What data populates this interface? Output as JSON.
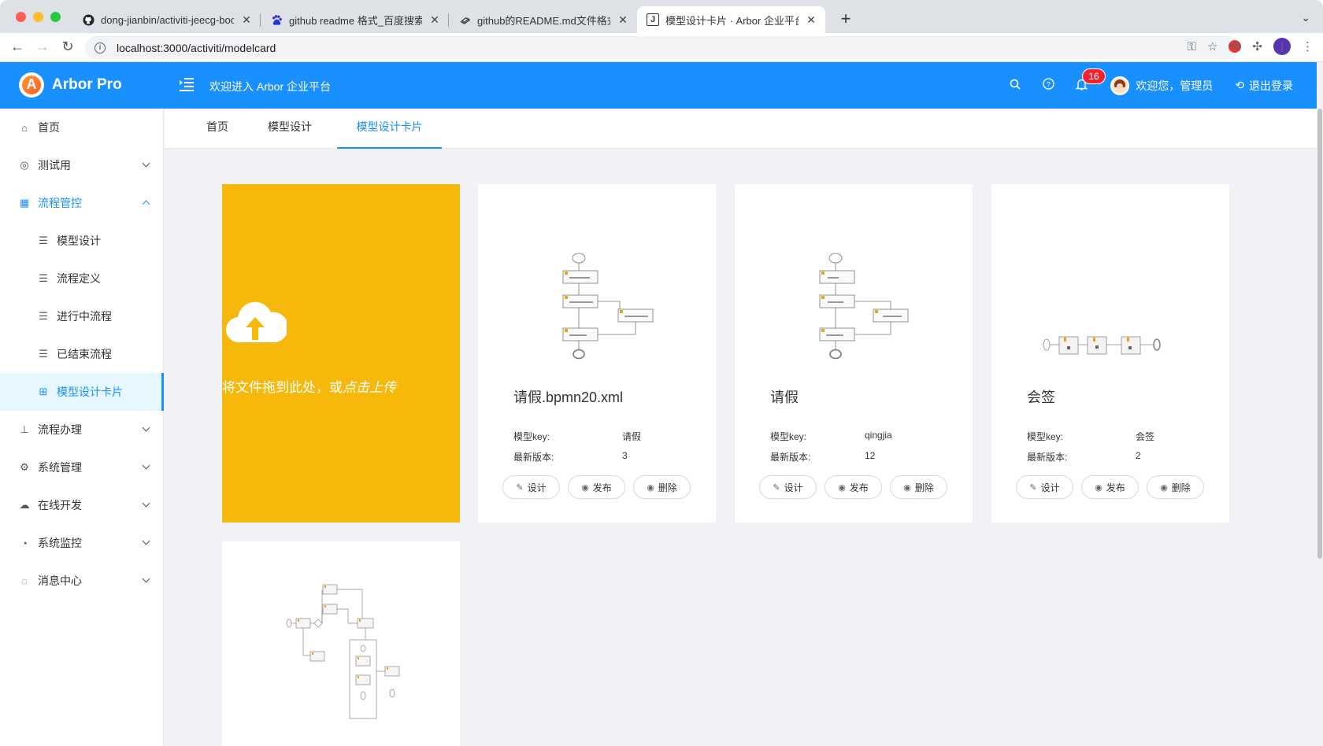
{
  "browser": {
    "tabs": [
      {
        "title": "dong-jianbin/activiti-jeecg-boo",
        "icon": "github-icon"
      },
      {
        "title": "github readme 格式_百度搜索",
        "icon": "baidu-icon"
      },
      {
        "title": "github的README.md文件格式",
        "icon": "gitbook-icon"
      },
      {
        "title": "模型设计卡片 · Arbor 企业平台",
        "icon": "j-icon",
        "active": true
      }
    ],
    "url": "localhost:3000/activiti/modelcard",
    "profile_initial": "j",
    "ext_label": "•B"
  },
  "header": {
    "brand": "Arbor Pro",
    "welcome": "欢迎进入 Arbor 企业平台",
    "notification_count": "16",
    "user_greeting": "欢迎您，管理员",
    "logout": "退出登录",
    "accent": "#1890ff"
  },
  "sidebar": {
    "items": [
      {
        "label": "首页",
        "icon": "home-icon"
      },
      {
        "label": "测试用",
        "icon": "globe-icon"
      },
      {
        "label": "流程管控",
        "icon": "dashboard-icon"
      },
      {
        "label": "模型设计",
        "icon": "list-icon"
      },
      {
        "label": "流程定义",
        "icon": "list-icon"
      },
      {
        "label": "进行中流程",
        "icon": "list-icon"
      },
      {
        "label": "已结束流程",
        "icon": "list-icon"
      },
      {
        "label": "模型设计卡片",
        "icon": "table-icon"
      },
      {
        "label": "流程办理",
        "icon": "cluster-icon"
      },
      {
        "label": "系统管理",
        "icon": "setting-icon"
      },
      {
        "label": "在线开发",
        "icon": "cloud-icon"
      },
      {
        "label": "系统监控",
        "icon": "monitor-icon"
      },
      {
        "label": "消息中心",
        "icon": "message-icon"
      }
    ]
  },
  "content_tabs": [
    "首页",
    "模型设计",
    "模型设计卡片"
  ],
  "upload": {
    "text_prefix": "将文件拖到此处，或",
    "text_link": "点击上传",
    "color": "#f5b80b"
  },
  "cards": [
    {
      "name": "请假.bpmn20.xml",
      "key_label": "模型key:",
      "key": "请假",
      "version_label": "最新版本:",
      "version": "3"
    },
    {
      "name": "请假",
      "key_label": "模型key:",
      "key": "qingjia",
      "version_label": "最新版本:",
      "version": "12"
    },
    {
      "name": "会签",
      "key_label": "模型key:",
      "key": "会签",
      "version_label": "最新版本:",
      "version": "2"
    }
  ],
  "card_buttons": {
    "design": "设计",
    "publish": "发布",
    "delete": "删除"
  }
}
